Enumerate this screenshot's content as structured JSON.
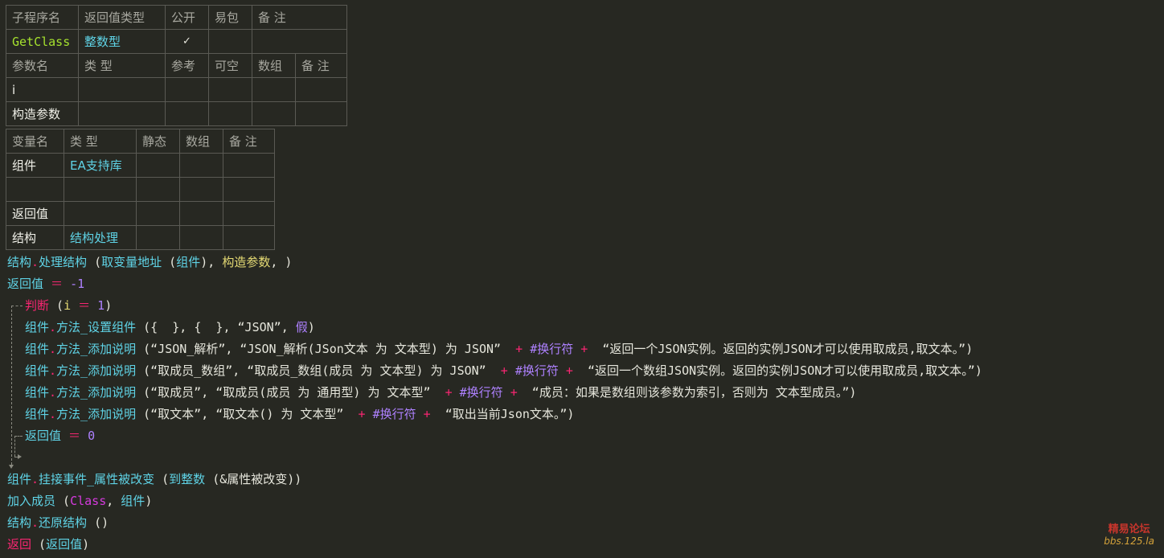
{
  "sub_table": {
    "headers": [
      "子程序名",
      "返回值类型",
      "公开",
      "易包",
      "备 注"
    ],
    "row": {
      "name": "GetClass",
      "return_type": "整数型",
      "public": "✓",
      "easy": "",
      "note": ""
    },
    "param_headers": [
      "参数名",
      "类 型",
      "参考",
      "可空",
      "数组",
      "备 注"
    ],
    "params": [
      {
        "name": "i",
        "type": ""
      },
      {
        "name": "构造参数",
        "type": ""
      }
    ]
  },
  "var_table": {
    "headers": [
      "变量名",
      "类 型",
      "静态",
      "数组",
      "备 注"
    ],
    "rows": [
      {
        "name": "组件",
        "type": "EA支持库"
      },
      {
        "name": "",
        "type": ""
      },
      {
        "name": "返回值",
        "type": ""
      },
      {
        "name": "结构",
        "type": "结构处理"
      }
    ]
  },
  "code": {
    "l1": {
      "obj": "结构",
      "dot": ".",
      "method": "处理结构",
      "open": " (",
      "fn": "取变量地址",
      "p1": " (",
      "arg": "组件",
      "p2": "), ",
      "arg2": "构造参数",
      "close": ", )"
    },
    "l2": {
      "var": "返回值",
      "op": " ＝ ",
      "num": "-1"
    },
    "l3": {
      "kw": "判断",
      "open": " (",
      "var": "i",
      "op": " ＝ ",
      "num": "1",
      "close": ")"
    },
    "l4": {
      "obj": "组件",
      "dot": ".",
      "method": "方法_设置组件",
      "rest": " ({  }, {  }, “JSON”, ",
      "const": "假",
      "close": ")"
    },
    "l5": {
      "obj": "组件",
      "dot": ".",
      "method": "方法_添加说明",
      "s1": " (“JSON_解析”, “JSON_解析(JSon文本 为 文本型) 为 JSON” ",
      "plus1": " + ",
      "nl": "#换行符",
      "plus2": " + ",
      "s2": " “返回一个JSON实例。返回的实例JSON才可以使用取成员,取文本。”)"
    },
    "l6": {
      "obj": "组件",
      "dot": ".",
      "method": "方法_添加说明",
      "s1": " (“取成员_数组”, “取成员_数组(成员 为 文本型) 为 JSON” ",
      "plus1": " + ",
      "nl": "#换行符",
      "plus2": " + ",
      "s2": " “返回一个数组JSON实例。返回的实例JSON才可以使用取成员,取文本。”)"
    },
    "l7": {
      "obj": "组件",
      "dot": ".",
      "method": "方法_添加说明",
      "s1": " (“取成员”, “取成员(成员 为 通用型) 为 文本型” ",
      "plus1": " + ",
      "nl": "#换行符",
      "plus2": " + ",
      "s2": " “成员：如果是数组则该参数为索引，否则为 文本型成员。”)"
    },
    "l8": {
      "obj": "组件",
      "dot": ".",
      "method": "方法_添加说明",
      "s1": " (“取文本”, “取文本() 为 文本型” ",
      "plus1": " + ",
      "nl": "#换行符",
      "plus2": " + ",
      "s2": " “取出当前Json文本。”)"
    },
    "l9": {
      "var": "返回值",
      "op": " ＝ ",
      "num": "0"
    },
    "l10": {
      "obj": "组件",
      "dot": ".",
      "method": "挂接事件_属性被改变",
      "open": " (",
      "fn": "到整数",
      "rest": " (&属性被改变))"
    },
    "l11": {
      "cmd": "加入成员",
      "open": " (",
      "const": "Class",
      "mid": ", ",
      "arg": "组件",
      "close": ")"
    },
    "l12": {
      "obj": "结构",
      "dot": ".",
      "method": "还原结构",
      "rest": " ()"
    },
    "l13": {
      "kw": "返回",
      "open": " (",
      "var": "返回值",
      "close": ")"
    }
  },
  "watermark": {
    "line1": "精易论坛",
    "line2": "bbs.125.la"
  },
  "colors": {
    "background": "#272822",
    "cyan": "#5fd3e6",
    "green": "#a6e22e",
    "pink": "#f92672",
    "purple": "#ae81ff",
    "yellow": "#e6db74"
  }
}
